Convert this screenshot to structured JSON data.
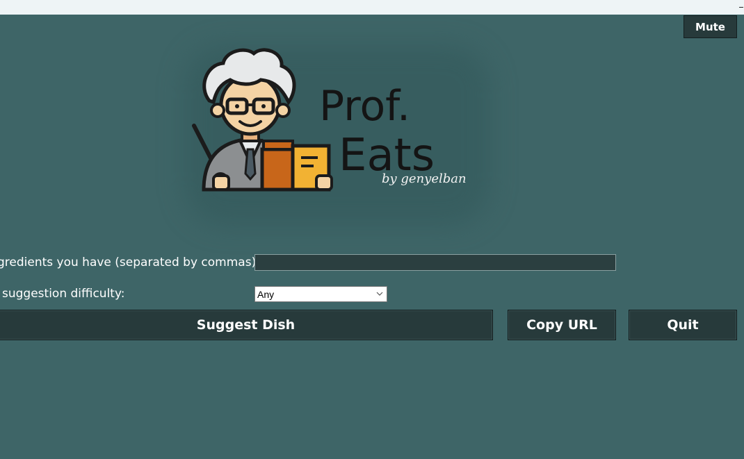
{
  "window": {
    "minimize_glyph": ""
  },
  "toolbar": {
    "mute_label": "Mute"
  },
  "logo": {
    "title_line1": "Prof.",
    "title_line2": "Eats",
    "byline": "by genyelban"
  },
  "form": {
    "ingredients_label": "gredients you have (separated by commas):",
    "ingredients_value": "",
    "difficulty_label": " suggestion difficulty:",
    "difficulty_selected": "Any"
  },
  "actions": {
    "suggest_label": "Suggest Dish",
    "copy_url_label": "Copy URL",
    "quit_label": "Quit"
  },
  "colors": {
    "background": "#3e6567",
    "button": "#273a3b",
    "input": "#2b3f40",
    "accent_orange": "#c8661a",
    "accent_yellow": "#f2b233"
  }
}
